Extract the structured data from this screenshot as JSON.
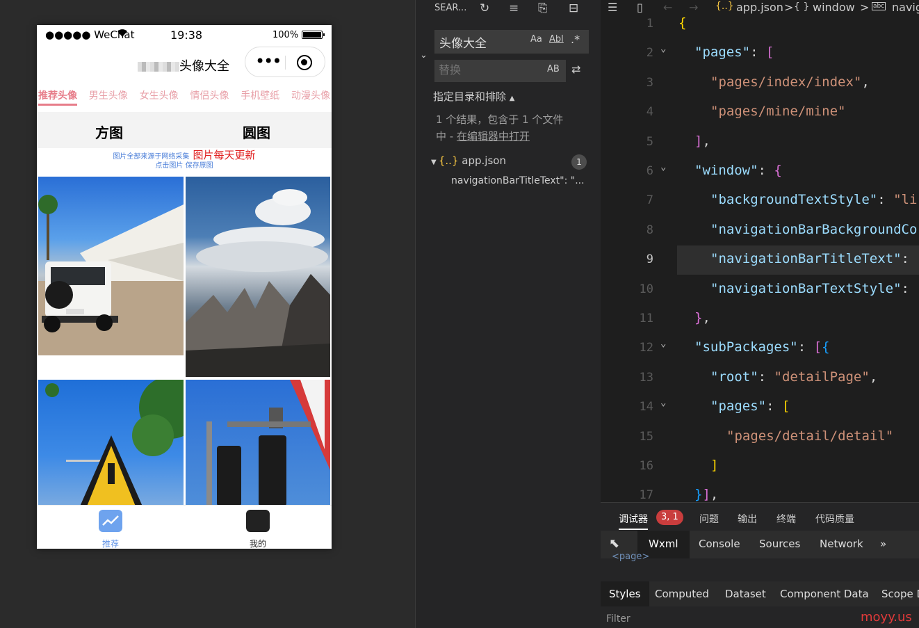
{
  "simulator": {
    "status": {
      "carrier": "●●●●● WeChat",
      "time": "19:38",
      "battery": "100%"
    },
    "nav_title": "头像大全",
    "categories": [
      "推荐头像",
      "男生头像",
      "女生头像",
      "情侣头像",
      "手机壁纸",
      "动漫头像"
    ],
    "shape_tabs": [
      "方图",
      "圆图"
    ],
    "notice_small": "图片全部来源于网络采集",
    "notice_big": "图片每天更新",
    "notice_line2": "点击图片 保存原图",
    "tabbar": [
      {
        "label": "推荐",
        "color": "#5a8fe6"
      },
      {
        "label": "我的",
        "color": "#222222"
      }
    ]
  },
  "search": {
    "header_title": "SEAR...",
    "query": "头像大全",
    "replace_placeholder": "替换",
    "opt_case": "Aa",
    "opt_word": "Abl",
    "opt_regex": ".*",
    "opt_preserve": "AB",
    "include_exclude": "指定目录和排除",
    "result_line1": "1 个结果，包含于 1 个文件",
    "result_line2_prefix": "中 - ",
    "result_line2_link": "在编辑器中打开",
    "file_icon": "{..}",
    "file_name": "app.json",
    "file_count": "1",
    "match_preview": "navigationBarTitleText\": \"..."
  },
  "editor": {
    "breadcrumb": {
      "file_icon": "{..}",
      "file": "app.json",
      "sep": ">",
      "obj_icon": "{ }",
      "obj": "window",
      "prop_icon": "abc",
      "prop": "navig"
    },
    "lines": [
      {
        "n": "1",
        "indent": 0,
        "parts": [
          [
            "b1",
            "{"
          ]
        ]
      },
      {
        "n": "2",
        "indent": 1,
        "fold": true,
        "parts": [
          [
            "k",
            "\"pages\""
          ],
          [
            "p",
            ": "
          ],
          [
            "b2",
            "["
          ]
        ]
      },
      {
        "n": "3",
        "indent": 2,
        "parts": [
          [
            "s",
            "\"pages/index/index\""
          ],
          [
            "p",
            ","
          ]
        ]
      },
      {
        "n": "4",
        "indent": 2,
        "parts": [
          [
            "s",
            "\"pages/mine/mine\""
          ]
        ]
      },
      {
        "n": "5",
        "indent": 1,
        "parts": [
          [
            "b2",
            "]"
          ],
          [
            "p",
            ","
          ]
        ]
      },
      {
        "n": "6",
        "indent": 1,
        "fold": true,
        "parts": [
          [
            "k",
            "\"window\""
          ],
          [
            "p",
            ": "
          ],
          [
            "b2",
            "{"
          ]
        ]
      },
      {
        "n": "7",
        "indent": 2,
        "parts": [
          [
            "k",
            "\"backgroundTextStyle\""
          ],
          [
            "p",
            ": "
          ],
          [
            "s",
            "\"li"
          ]
        ]
      },
      {
        "n": "8",
        "indent": 2,
        "parts": [
          [
            "k",
            "\"navigationBarBackgroundCo"
          ]
        ]
      },
      {
        "n": "9",
        "indent": 2,
        "current": true,
        "parts": [
          [
            "k",
            "\"navigationBarTitleText\""
          ],
          [
            "p",
            ":"
          ]
        ]
      },
      {
        "n": "10",
        "indent": 2,
        "parts": [
          [
            "k",
            "\"navigationBarTextStyle\""
          ],
          [
            "p",
            ":"
          ]
        ]
      },
      {
        "n": "11",
        "indent": 1,
        "parts": [
          [
            "b2",
            "}"
          ],
          [
            "p",
            ","
          ]
        ]
      },
      {
        "n": "12",
        "indent": 1,
        "fold": true,
        "parts": [
          [
            "k",
            "\"subPackages\""
          ],
          [
            "p",
            ": "
          ],
          [
            "b2",
            "["
          ],
          [
            "b3",
            "{"
          ]
        ]
      },
      {
        "n": "13",
        "indent": 2,
        "parts": [
          [
            "k",
            "\"root\""
          ],
          [
            "p",
            ": "
          ],
          [
            "s",
            "\"detailPage\""
          ],
          [
            "p",
            ","
          ]
        ]
      },
      {
        "n": "14",
        "indent": 2,
        "fold": true,
        "parts": [
          [
            "k",
            "\"pages\""
          ],
          [
            "p",
            ": "
          ],
          [
            "b1",
            "["
          ]
        ]
      },
      {
        "n": "15",
        "indent": 3,
        "parts": [
          [
            "s",
            "\"pages/detail/detail\""
          ]
        ]
      },
      {
        "n": "16",
        "indent": 2,
        "parts": [
          [
            "b1",
            "]"
          ]
        ]
      },
      {
        "n": "17",
        "indent": 1,
        "parts": [
          [
            "b3",
            "}"
          ],
          [
            "b2",
            "]"
          ],
          [
            "p",
            ","
          ]
        ]
      }
    ]
  },
  "debugger": {
    "tabs": [
      "调试器",
      "问题",
      "输出",
      "终端",
      "代码质量"
    ],
    "error_badge": "3, 1",
    "tool_tabs": [
      "Wxml",
      "Console",
      "Sources",
      "Network"
    ],
    "more": "»",
    "wxml_stub": "<page>",
    "style_tabs": [
      "Styles",
      "Computed",
      "Dataset",
      "Component Data",
      "Scope D"
    ],
    "filter_label": "Filter",
    "watermark": "moyy.us"
  }
}
